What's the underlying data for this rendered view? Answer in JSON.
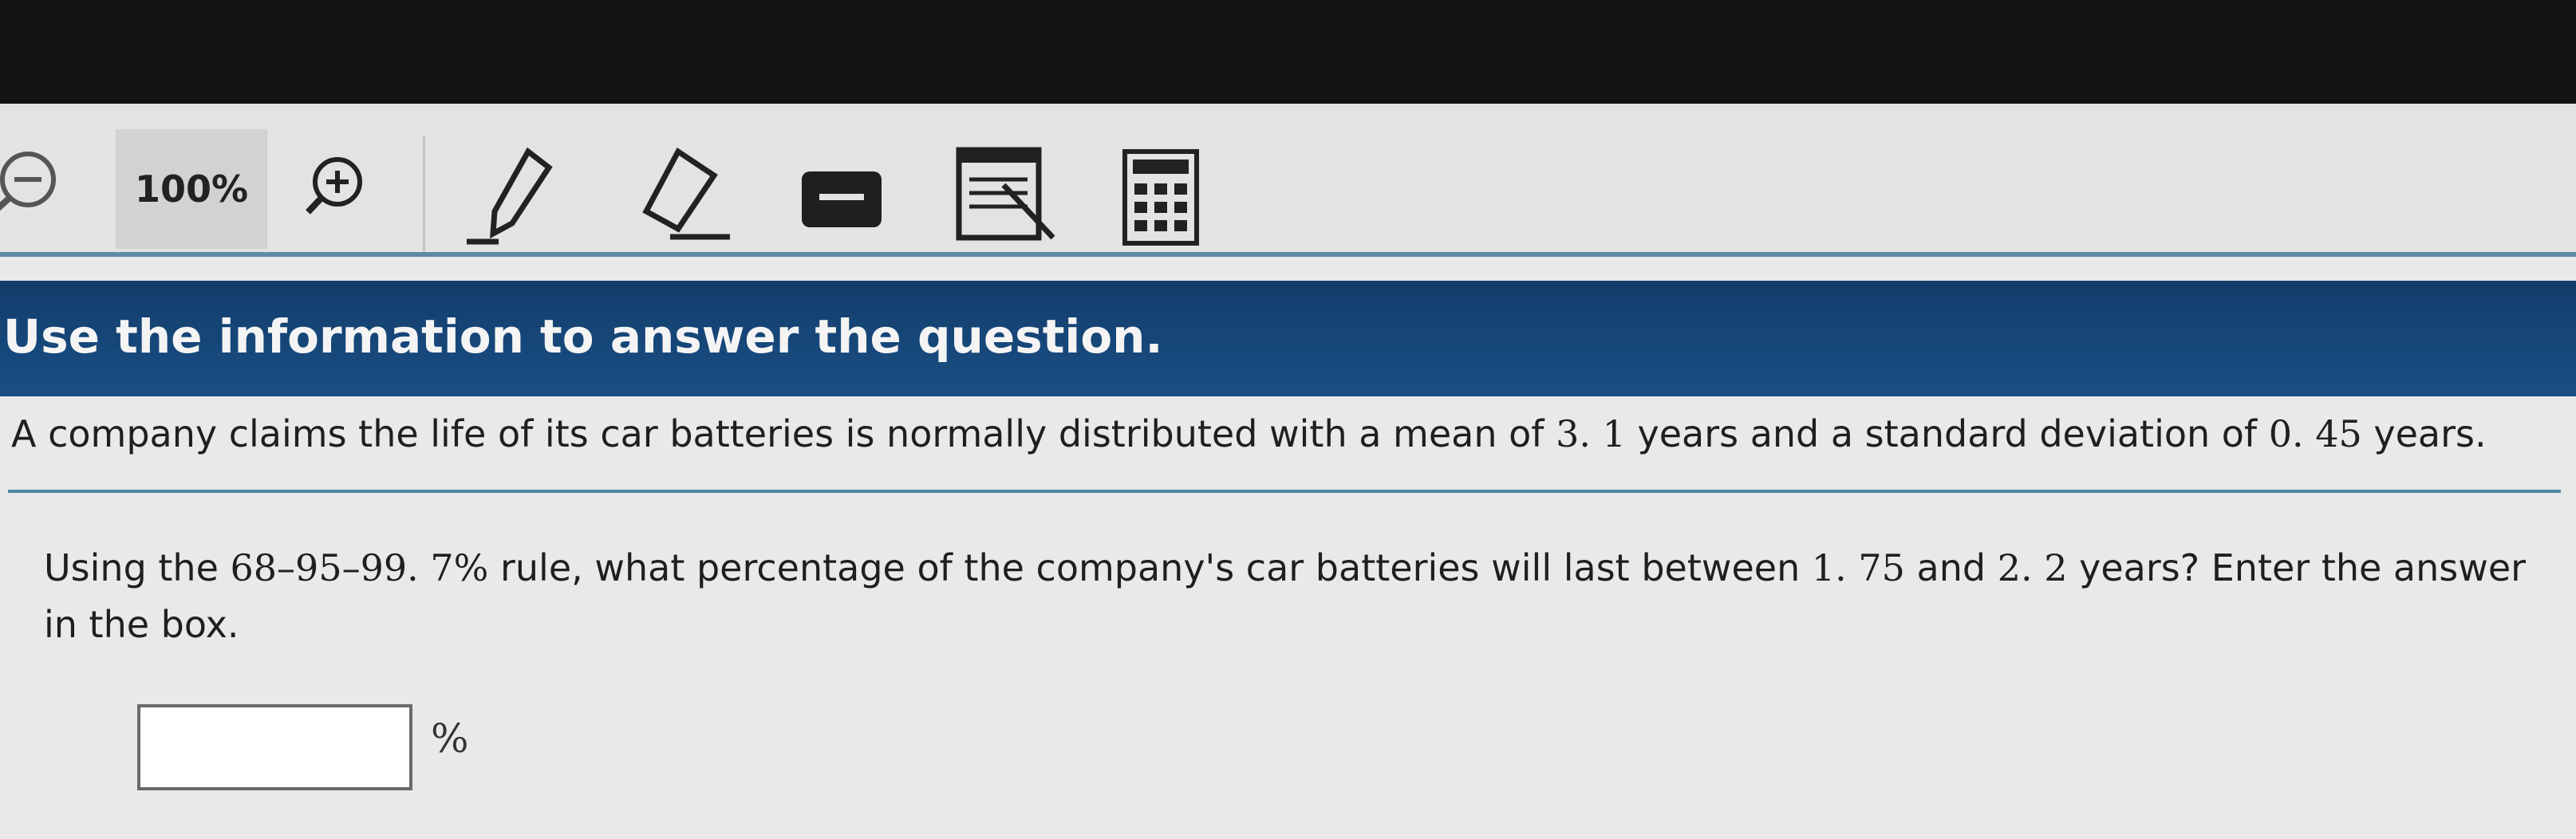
{
  "toolbar": {
    "zoom_level": "100%",
    "icons": [
      "zoom-out-icon",
      "zoom-in-icon",
      "pencil-icon",
      "eraser-icon",
      "highlighter-icon",
      "notepad-icon",
      "calculator-icon"
    ]
  },
  "header": {
    "title": "Use the information to answer the question."
  },
  "stem": {
    "part1": "A company claims the life of its car batteries is normally distributed with a mean of ",
    "mean": "3. 1",
    "part2": " years and a standard deviation of ",
    "sd": "0. 45",
    "part3": " years."
  },
  "question": {
    "part1": "Using the ",
    "rule": "68–95–99. 7%",
    "part2": " rule, what percentage of the company's car batteries will last between ",
    "low": "1. 75",
    "part3": " and ",
    "high": "2. 2",
    "part4": " years? Enter the answer in the box."
  },
  "answer": {
    "value": "",
    "unit": "%"
  },
  "colors": {
    "header_bg": "#1a4f84",
    "rule": "#4e86a3"
  }
}
